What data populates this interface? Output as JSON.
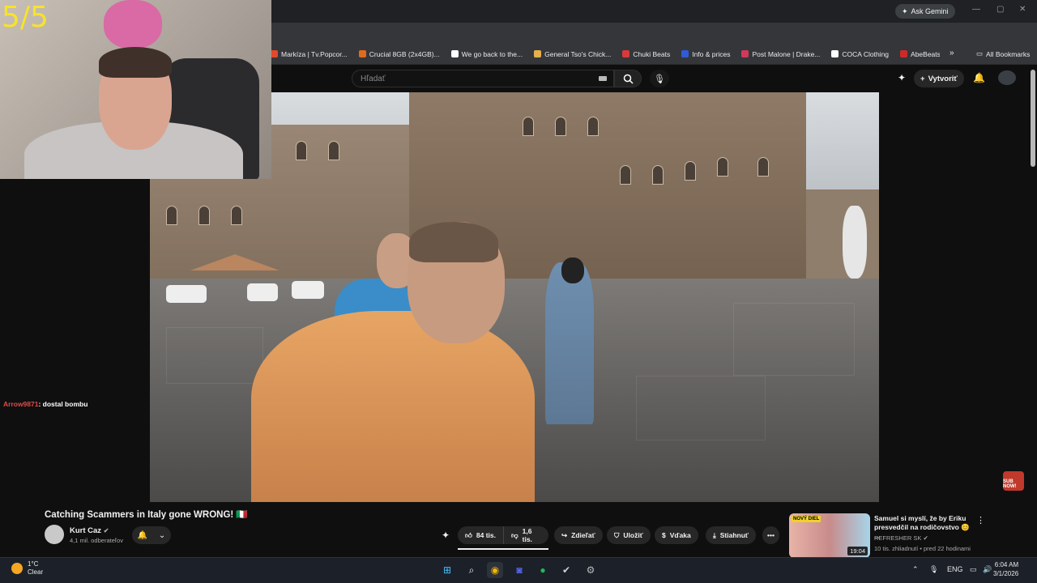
{
  "overlay": {
    "counter": "5/5",
    "chat_user": "Arrow9871",
    "chat_message": ": dostal bombu"
  },
  "browser": {
    "ask_gemini": "Ask Gemini",
    "bookmarks": [
      {
        "label": "Markíza | Tv.Popcor...",
        "color": "#e0492b"
      },
      {
        "label": "Crucial 8GB (2x4GB)...",
        "color": "#e06a1f"
      },
      {
        "label": "We go back to the...",
        "color": "#ffffff"
      },
      {
        "label": "General Tso's Chick...",
        "color": "#e3b04b"
      },
      {
        "label": "Chuki Beats",
        "color": "#d83a3a"
      },
      {
        "label": "Info & prices",
        "color": "#2f5bd6"
      },
      {
        "label": "Post Malone | Drake...",
        "color": "#d0395a"
      },
      {
        "label": "COCA Clothing",
        "color": "#ffffff"
      },
      {
        "label": "AbeBeats",
        "color": "#cc2a2a"
      }
    ],
    "all_bookmarks": "All Bookmarks"
  },
  "youtube": {
    "search_placeholder": "Hľadať",
    "create_label": "Vytvoriť",
    "video_title": "Catching Scammers in Italy gone WRONG! 🇮🇹",
    "channel_name": "Kurt Caz",
    "subscribers": "4,1 mil. odberateľov",
    "likes": "84 tis.",
    "dislikes": "1,6 tis.",
    "share": "Zdieľať",
    "save": "Uložiť",
    "thanks": "Vďaka",
    "download": "Stiahnuť",
    "recommended": {
      "title": "Samuel si myslí, že by Eriku presvedčil na rodičovstvo 😊 ...",
      "channel": "REFRESHER SK",
      "meta": "10 tis. zhliadnutí • pred 22 hodinami",
      "duration": "19:04",
      "thumb_tag": "NOVÝ DIEL"
    },
    "sub_badge": "SUB NOW!"
  },
  "taskbar": {
    "weather_temp": "1°C",
    "weather_desc": "Clear",
    "lang": "ENG",
    "time": "6:04 AM",
    "date": "3/1/2026"
  },
  "colors": {
    "bg": "#0f0f0f",
    "accent": "#f7e32a",
    "taskbar": "#1c2129"
  }
}
